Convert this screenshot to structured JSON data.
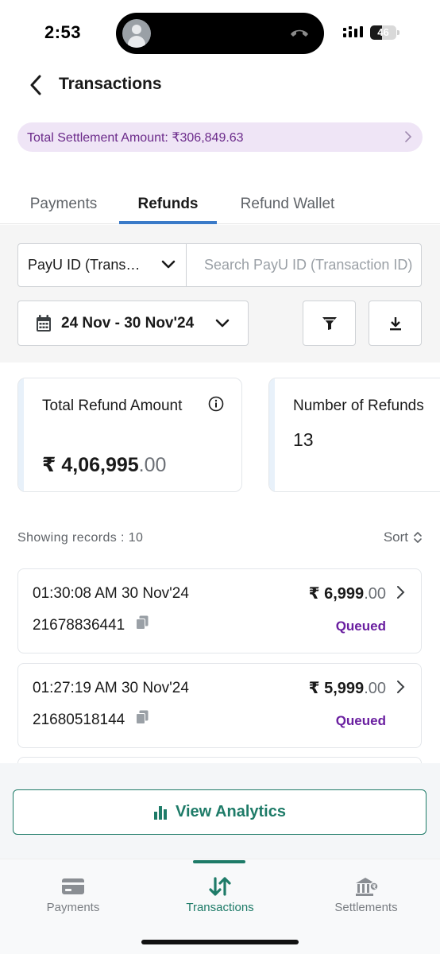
{
  "status_bar": {
    "time": "2:53",
    "battery": "46",
    "battery_level": 0.46
  },
  "header": {
    "title": "Transactions"
  },
  "settlement": {
    "label": "Total Settlement Amount: ₹306,849.63"
  },
  "tabs": [
    {
      "label": "Payments",
      "active": false
    },
    {
      "label": "Refunds",
      "active": true
    },
    {
      "label": "Refund Wallet",
      "active": false
    }
  ],
  "filters": {
    "id_type": "PayU ID (Trans…",
    "search_placeholder": "Search PayU ID (Transaction ID)",
    "date_range": "24 Nov - 30 Nov'24"
  },
  "summary": {
    "total_label": "Total Refund Amount",
    "total_value_main": "₹ 4,06,995",
    "total_value_dec": ".00",
    "count_label": "Number of Refunds",
    "count_value": "13"
  },
  "records": {
    "label": "Showing records : 10",
    "sort_label": "Sort"
  },
  "refunds": [
    {
      "time": "01:30:08 AM 30 Nov'24",
      "id": "21678836441",
      "amount_main": "₹ 6,999",
      "amount_dec": ".00",
      "status": "Queued"
    },
    {
      "time": "01:27:19 AM 30 Nov'24",
      "id": "21680518144",
      "amount_main": "₹ 5,999",
      "amount_dec": ".00",
      "status": "Queued"
    }
  ],
  "analytics": {
    "label": "View Analytics"
  },
  "bottom_nav": [
    {
      "label": "Payments",
      "icon": "card-icon",
      "active": false
    },
    {
      "label": "Transactions",
      "icon": "transfer-arrows-icon",
      "active": true
    },
    {
      "label": "Settlements",
      "icon": "bank-icon",
      "active": false
    }
  ],
  "colors": {
    "accent_purple": "#6a1fa0",
    "brand_green": "#1e7b68",
    "tab_blue": "#3a7ac8",
    "banner_bg": "#efe5f6"
  }
}
